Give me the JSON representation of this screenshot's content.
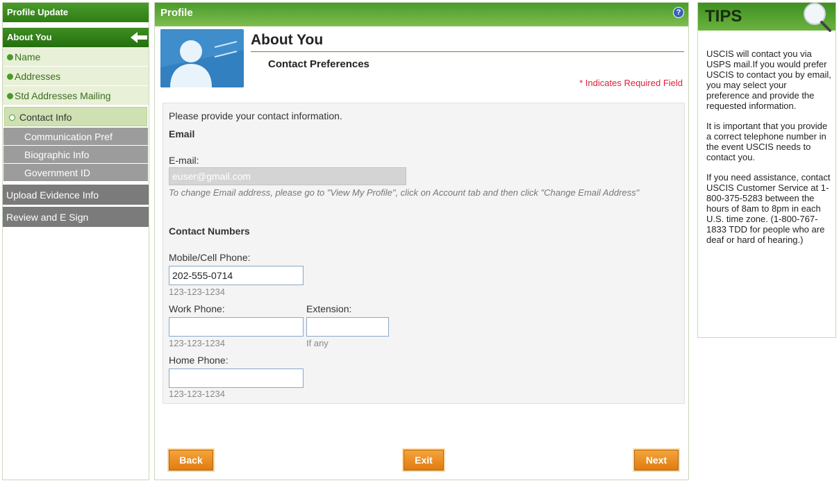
{
  "sidebar": {
    "title": "Profile Update",
    "about_you": "About You",
    "items": [
      {
        "label": "Name"
      },
      {
        "label": "Addresses"
      },
      {
        "label": "Std Addresses Mailing"
      }
    ],
    "active_item": "Contact Info",
    "gray_items": [
      {
        "label": "Communication Pref"
      },
      {
        "label": "Biographic Info"
      },
      {
        "label": "Government ID"
      }
    ],
    "upload": "Upload Evidence Info",
    "review": "Review and E Sign"
  },
  "main": {
    "header_title": "Profile",
    "help_icon": "?",
    "section_title": "About You",
    "section_subtitle": "Contact Preferences",
    "required_note": "* Indicates Required Field",
    "intro": "Please provide your contact information.",
    "email_heading": "Email",
    "email_label": "E-mail:",
    "email_value": "euser@gmail.com",
    "email_note": "To change Email address, please go to \"View My Profile\", click on Account tab and then click \"Change Email Address\"",
    "contact_heading": "Contact Numbers",
    "mobile_label": "Mobile/Cell Phone:",
    "mobile_value": "202-555-0714",
    "mobile_hint": "123-123-1234",
    "work_label": "Work Phone:",
    "work_value": "",
    "work_hint": "123-123-1234",
    "ext_label": "Extension:",
    "ext_value": "",
    "ext_hint": "If any",
    "home_label": "Home Phone:",
    "home_value": "",
    "home_hint": "123-123-1234"
  },
  "buttons": {
    "back": "Back",
    "exit": "Exit",
    "next": "Next"
  },
  "tips": {
    "title": "TIPS",
    "p1": "USCIS will contact you via USPS mail.If you would prefer USCIS to contact you by email, you may select your preference and provide the requested information.",
    "p2": "It is important that you provide a correct telephone number in the event USCIS needs to contact you.",
    "p3": "If you need assistance, contact USCIS Customer Service at 1-800-375-5283 between the hours of 8am to 8pm in each U.S. time zone. (1-800-767-1833 TDD for people who are deaf or hard of hearing.)"
  },
  "colors": {
    "brand_green": "#2f7d15",
    "button_orange": "#e07c12",
    "required_red": "#e0203a"
  },
  "icons": [
    "back-arrow-icon",
    "help-icon",
    "user-avatar-icon",
    "magnifier-icon",
    "bullet-dot-icon"
  ]
}
